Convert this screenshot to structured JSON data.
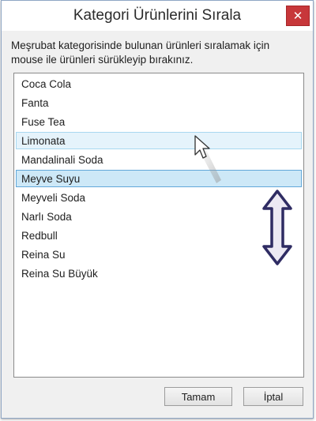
{
  "dialog": {
    "title": "Kategori Ürünlerini Sırala",
    "close_label": "✕",
    "instructions_line1": "Meşrubat kategorisinde bulunan ürünleri sıralamak için",
    "instructions_line2": "mouse ile ürünleri sürükleyip bırakınız."
  },
  "list": {
    "items": [
      {
        "label": "Coca Cola",
        "state": "normal"
      },
      {
        "label": "Fanta",
        "state": "normal"
      },
      {
        "label": "Fuse Tea",
        "state": "normal"
      },
      {
        "label": "Limonata",
        "state": "hover"
      },
      {
        "label": "Mandalinali Soda",
        "state": "normal"
      },
      {
        "label": "Meyve Suyu",
        "state": "selected"
      },
      {
        "label": "Meyveli Soda",
        "state": "normal"
      },
      {
        "label": "Narlı Soda",
        "state": "normal"
      },
      {
        "label": "Redbull",
        "state": "normal"
      },
      {
        "label": "Reina Su",
        "state": "normal"
      },
      {
        "label": "Reina Su Büyük",
        "state": "normal"
      }
    ]
  },
  "buttons": {
    "ok_label": "Tamam",
    "cancel_label": "İptal"
  },
  "icons": {
    "cursor": "mouse-pointer-icon",
    "drag": "up-down-arrow-icon"
  },
  "colors": {
    "close_button": "#c7373a",
    "selected_row": "#cde8f7",
    "hover_row": "#e5f3fb",
    "arrow_fill": "#ece9f3",
    "arrow_stroke": "#2f2c63"
  }
}
